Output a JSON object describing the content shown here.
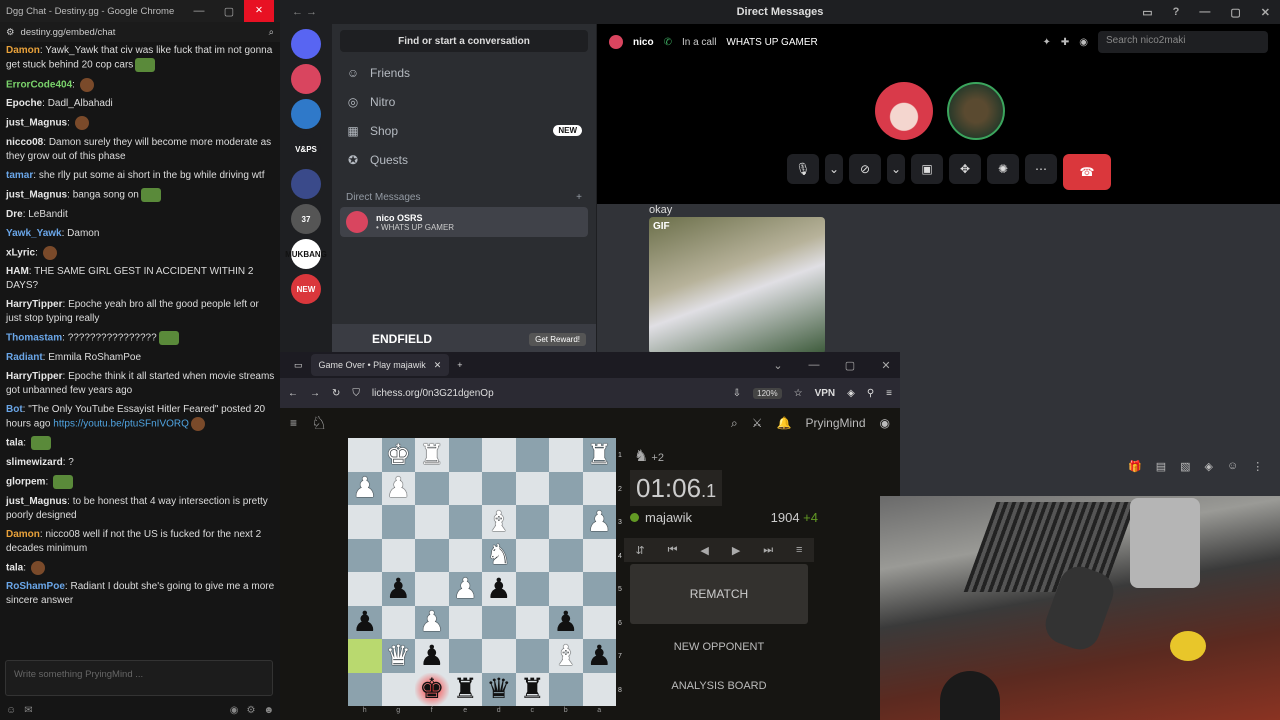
{
  "chat": {
    "window_title": "Dgg Chat - Destiny.gg - Google Chrome",
    "url": "destiny.gg/embed/chat",
    "input_placeholder": "Write something PryingMind ...",
    "messages": [
      {
        "name": "Damon",
        "color": "#e8a13a",
        "text": "Yawk_Yawk that civ was like fuck that im not gonna get stuck behind 20 cop cars"
      },
      {
        "name": "ErrorCode404",
        "color": "#7ad36b",
        "text": ""
      },
      {
        "name": "Epoche",
        "color": "#e6e6e6",
        "text": "Dadl_Albahadi"
      },
      {
        "name": "just_Magnus",
        "color": "#e6e6e6",
        "text": ""
      },
      {
        "name": "nicco08",
        "color": "#e6e6e6",
        "text": "Damon surely they will become more moderate as they grow out of this phase"
      },
      {
        "name": "tamar",
        "color": "#6aa6e8",
        "text": "she rlly put some ai short in the bg while driving wtf"
      },
      {
        "name": "just_Magnus",
        "color": "#e6e6e6",
        "text": "banga song on"
      },
      {
        "name": "Dre",
        "color": "#e6e6e6",
        "text": "LeBandit"
      },
      {
        "name": "Yawk_Yawk",
        "color": "#6aa6e8",
        "text": "Damon"
      },
      {
        "name": "xLyric",
        "color": "#e6e6e6",
        "text": ""
      },
      {
        "name": "HAM",
        "color": "#e6e6e6",
        "text": "THE SAME GIRL GEST IN ACCIDENT WITHIN 2 DAYS?"
      },
      {
        "name": "HarryTipper",
        "color": "#e6e6e6",
        "text": "Epoche yeah bro all the good people left or just stop typing really"
      },
      {
        "name": "Thomastam",
        "color": "#6aa6e8",
        "text": "????????????????"
      },
      {
        "name": "Radiant",
        "color": "#6aa6e8",
        "text": "Emmila RoShamPoe"
      },
      {
        "name": "HarryTipper",
        "color": "#e6e6e6",
        "text": "Epoche think it all started when movie streams got unbanned few years ago"
      },
      {
        "name": "Bot",
        "color": "#6aa6e8",
        "text": "\"The Only YouTube Essayist Hitler Feared\" posted 20 hours ago",
        "link": "https://youtu.be/ptuSFnIVORQ"
      },
      {
        "name": "tala",
        "color": "#e6e6e6",
        "text": ""
      },
      {
        "name": "slimewizard",
        "color": "#e6e6e6",
        "text": "?"
      },
      {
        "name": "glorpem",
        "color": "#e6e6e6",
        "text": ""
      },
      {
        "name": "just_Magnus",
        "color": "#e6e6e6",
        "text": "to be honest that 4 way intersection is pretty poorly designed"
      },
      {
        "name": "Damon",
        "color": "#e8a13a",
        "text": "nicco08 well if not the US is fucked for the next 2 decades minimum"
      },
      {
        "name": "tala",
        "color": "#e6e6e6",
        "text": ""
      },
      {
        "name": "RoShamPoe",
        "color": "#6aa6e8",
        "text": "Radiant I doubt she's going to give me a more sincere answer"
      }
    ]
  },
  "discord": {
    "title": "Direct Messages",
    "find_label": "Find or start a conversation",
    "nav": [
      {
        "label": "Friends",
        "icon": "person-wave-icon"
      },
      {
        "label": "Nitro",
        "icon": "nitro-icon"
      },
      {
        "label": "Shop",
        "icon": "shop-icon",
        "badge": "NEW"
      },
      {
        "label": "Quests",
        "icon": "quests-icon"
      }
    ],
    "dm_header": "Direct Messages",
    "dm_entry": {
      "name": "nico",
      "tag": "OSRS",
      "status": "• WHATS UP GAMER"
    },
    "servers": [
      {
        "label": "",
        "color": "#5865f2"
      },
      {
        "label": "",
        "color": "#d9455f"
      },
      {
        "label": "",
        "color": "#2f79c9"
      },
      {
        "label": "V&PS",
        "color": "#1e1f22"
      },
      {
        "label": "",
        "color": "#3a4a8a"
      },
      {
        "label": "37",
        "color": "#555"
      },
      {
        "label": "MUKBANG",
        "color": "#fff"
      },
      {
        "label": "NEW",
        "color": "#da373c"
      }
    ],
    "banner_text": "ENDFIELD",
    "banner_button": "Get Reward!",
    "call": {
      "user": "nico",
      "status": "In a call",
      "custom_status": "WHATS UP GAMER",
      "search_placeholder": "Search nico2maki"
    },
    "message": {
      "text": "okay",
      "gif_label": "GIF"
    }
  },
  "lichess": {
    "tab_title": "Game Over • Play majawik",
    "url": "lichess.org/0n3G21dgenOp",
    "zoom": "120%",
    "vpn": "VPN",
    "username": "PryingMind",
    "material": "+2",
    "clock_main": "01:06",
    "clock_tenth": ".1",
    "opponent": "majawik",
    "rating": "1904",
    "rating_change": "+4",
    "rematch": "REMATCH",
    "new_opponent": "NEW OPPONENT",
    "analysis": "ANALYSIS BOARD",
    "ranks": [
      "1",
      "2",
      "3",
      "4",
      "5",
      "6",
      "7",
      "8"
    ],
    "files": [
      "h",
      "g",
      "f",
      "e",
      "d",
      "c",
      "b",
      "a"
    ],
    "board": [
      [
        "",
        "♚",
        "♜",
        "",
        "",
        "",
        "",
        "♜"
      ],
      [
        "♟",
        "♟",
        "",
        "",
        "",
        "",
        "",
        ""
      ],
      [
        "",
        "",
        "",
        "",
        "♝",
        "",
        "",
        "♟"
      ],
      [
        "",
        "",
        "",
        "",
        "♞",
        "",
        "",
        ""
      ],
      [
        "",
        "♟",
        "",
        "♟",
        "♟",
        "",
        "",
        ""
      ],
      [
        "♟",
        "",
        "♟",
        "",
        "",
        "",
        "♟",
        ""
      ],
      [
        "",
        "♛",
        "♟",
        "",
        "",
        "",
        "♝",
        "♟"
      ],
      [
        "",
        "",
        "♚",
        "♜",
        "♛",
        "♜",
        "",
        ""
      ]
    ],
    "board_colors": [
      [
        "",
        "w",
        "w",
        "",
        "",
        "",
        "",
        "w"
      ],
      [
        "w",
        "w",
        "",
        "",
        "",
        "",
        "",
        ""
      ],
      [
        "",
        "",
        "",
        "",
        "w",
        "",
        "",
        "w"
      ],
      [
        "",
        "",
        "",
        "",
        "w",
        "",
        "",
        ""
      ],
      [
        "",
        "b",
        "",
        "w",
        "b",
        "",
        "",
        ""
      ],
      [
        "b",
        "",
        "w",
        "",
        "",
        "",
        "b",
        ""
      ],
      [
        "",
        "w",
        "b",
        "",
        "",
        "",
        "w",
        "b"
      ],
      [
        "",
        "",
        "b",
        "b",
        "b",
        "b",
        "",
        ""
      ]
    ]
  }
}
